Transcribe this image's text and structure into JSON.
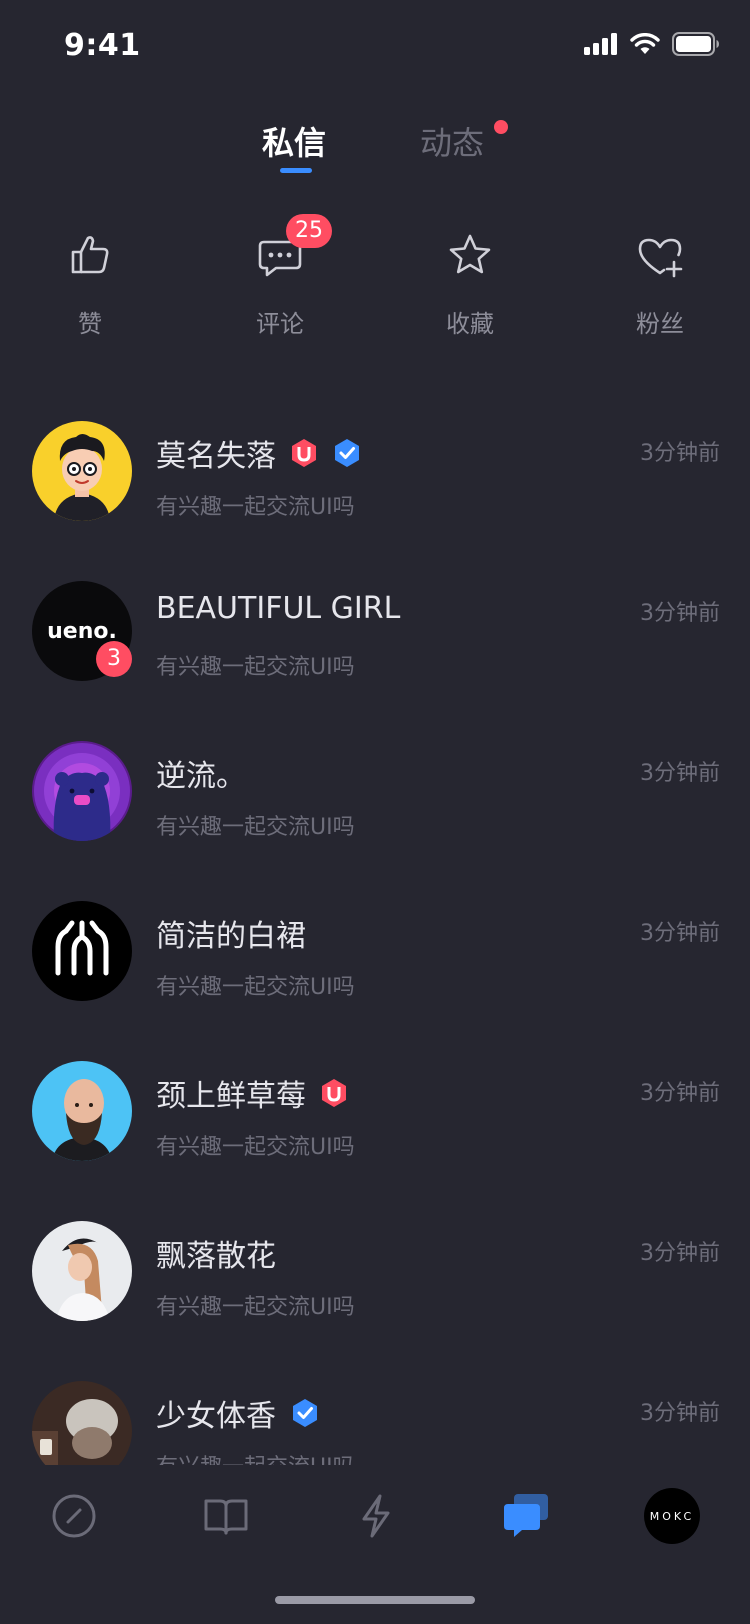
{
  "status_bar": {
    "time": "9:41"
  },
  "tabs": [
    {
      "label": "私信",
      "active": true
    },
    {
      "label": "动态",
      "active": false,
      "has_dot": true
    }
  ],
  "quick_actions": [
    {
      "label": "赞",
      "icon": "thumbs-up-icon"
    },
    {
      "label": "评论",
      "icon": "comment-icon",
      "badge": "25"
    },
    {
      "label": "收藏",
      "icon": "star-icon"
    },
    {
      "label": "粉丝",
      "icon": "heart-plus-icon"
    }
  ],
  "messages": [
    {
      "name": "莫名失落",
      "preview": "有兴趣一起交流UI吗",
      "time": "3分钟前",
      "badges": [
        "u-badge",
        "verified-badge"
      ],
      "avatar": "cartoon-avatar"
    },
    {
      "name": "BEAUTIFUL GIRL",
      "preview": "有兴趣一起交流UI吗",
      "time": "3分钟前",
      "unread": "3",
      "avatar": "ueno-logo-avatar",
      "avatar_text": "ueno."
    },
    {
      "name": "逆流。",
      "preview": "有兴趣一起交流UI吗",
      "time": "3分钟前",
      "avatar": "bear-avatar"
    },
    {
      "name": "简洁的白裙",
      "preview": "有兴趣一起交流UI吗",
      "time": "3分钟前",
      "avatar": "line-logo-avatar"
    },
    {
      "name": "颈上鲜草莓",
      "preview": "有兴趣一起交流UI吗",
      "time": "3分钟前",
      "badges": [
        "u-badge"
      ],
      "avatar": "bald-man-avatar"
    },
    {
      "name": "飘落散花",
      "preview": "有兴趣一起交流UI吗",
      "time": "3分钟前",
      "avatar": "woman-avatar"
    },
    {
      "name": "少女体香",
      "preview": "有兴趣一起交流UI吗",
      "time": "3分钟前",
      "badges": [
        "verified-badge"
      ],
      "avatar": "photo-avatar"
    }
  ],
  "bottom_nav": [
    {
      "icon": "compass-icon",
      "active": false
    },
    {
      "icon": "book-icon",
      "active": false
    },
    {
      "icon": "lightning-icon",
      "active": false
    },
    {
      "icon": "messages-icon",
      "active": true
    },
    {
      "icon": "profile-avatar-icon",
      "active": false,
      "text": "MOKC"
    }
  ],
  "colors": {
    "background": "#262630",
    "accent": "#3a8dff",
    "alert": "#ff4d62"
  }
}
